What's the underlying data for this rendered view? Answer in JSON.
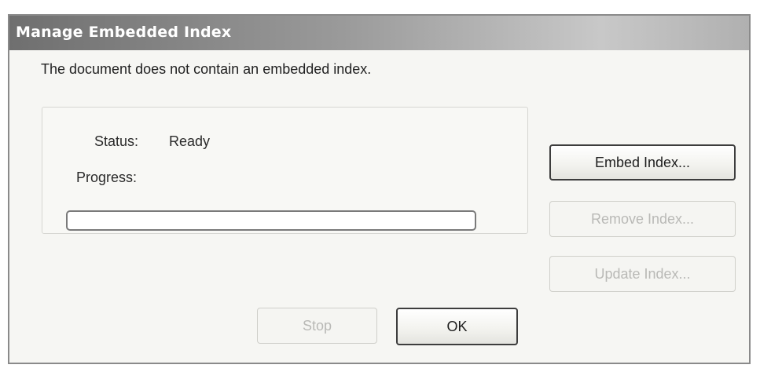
{
  "window": {
    "title": "Manage Embedded Index"
  },
  "message": "The document does not contain an embedded index.",
  "status": {
    "label": "Status:",
    "value": "Ready"
  },
  "progress": {
    "label": "Progress:",
    "percent": 0
  },
  "buttons": {
    "embed_index": {
      "label": "Embed Index...",
      "enabled": true
    },
    "remove_index": {
      "label": "Remove Index...",
      "enabled": false
    },
    "update_index": {
      "label": "Update Index...",
      "enabled": false
    },
    "stop": {
      "label": "Stop",
      "enabled": false
    },
    "ok": {
      "label": "OK",
      "enabled": true
    }
  },
  "colors": {
    "title_text": "#ffffff",
    "disabled_text": "#b9b9b6",
    "dialog_background": "#f4f4f2"
  }
}
